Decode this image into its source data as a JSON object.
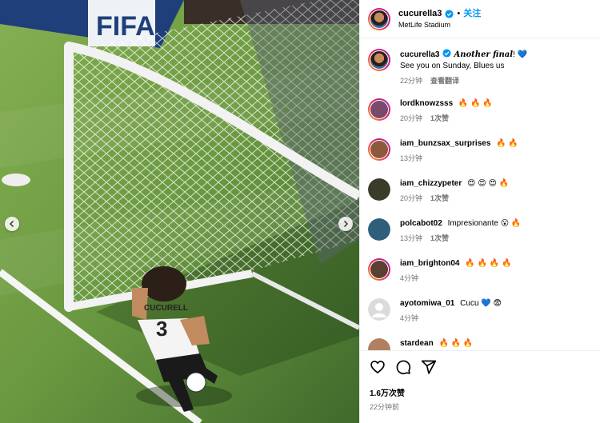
{
  "photo": {
    "billboard_text": "FIFA",
    "jersey_name": "CUCURELL",
    "jersey_number": "3",
    "prev_icon": "chevron-left-icon",
    "next_icon": "chevron-right-icon"
  },
  "header": {
    "username": "cucurella3",
    "follow_label": "关注",
    "location": "MetLife Stadium",
    "separator": "•"
  },
  "caption": {
    "username": "cucurella3",
    "text_bold": "Another final",
    "text_after": "!",
    "heart": "💙",
    "line2": "See you on Sunday, Blues us",
    "time": "22分钟",
    "translate_label": "查看翻译"
  },
  "comments": [
    {
      "username": "lordknowzsss",
      "text": "🔥 🔥 🔥",
      "time": "20分钟",
      "likes": "1次赞",
      "avatar_color": "#7a4a6b",
      "ring": true
    },
    {
      "username": "iam_bunzsax_surprises",
      "text": "🔥 🔥",
      "time": "13分钟",
      "likes": "",
      "avatar_color": "#8b5a3c",
      "ring": true
    },
    {
      "username": "iam_chizzypeter",
      "text": "😍 😍 😍 🔥",
      "time": "20分钟",
      "likes": "1次赞",
      "avatar_color": "#3b3b2a",
      "ring": false
    },
    {
      "username": "polcabot02",
      "text": "Impresionante 😮 🔥",
      "time": "13分钟",
      "likes": "1次赞",
      "avatar_color": "#2f5e7a",
      "ring": false
    },
    {
      "username": "iam_brighton04",
      "text": "🔥 🔥 🔥 🔥",
      "time": "4分钟",
      "likes": "",
      "avatar_color": "#5a4030",
      "ring": true
    },
    {
      "username": "ayotomiwa_01",
      "text": "Cucu 💙 😨",
      "time": "4分钟",
      "likes": "",
      "avatar_color": "#c7c7c7",
      "ring": false
    },
    {
      "username": "stardean",
      "text": "🔥 🔥 🔥",
      "time": "",
      "likes": "",
      "avatar_color": "#b08060",
      "ring": false
    }
  ],
  "footer": {
    "like_icon": "heart-icon",
    "comment_icon": "comment-icon",
    "share_icon": "share-icon",
    "likes_count": "1.6万次赞",
    "posted_time": "22分钟前"
  },
  "colors": {
    "accent": "#0095f6",
    "meta_gray": "#737373",
    "verified": "#0095f6"
  }
}
